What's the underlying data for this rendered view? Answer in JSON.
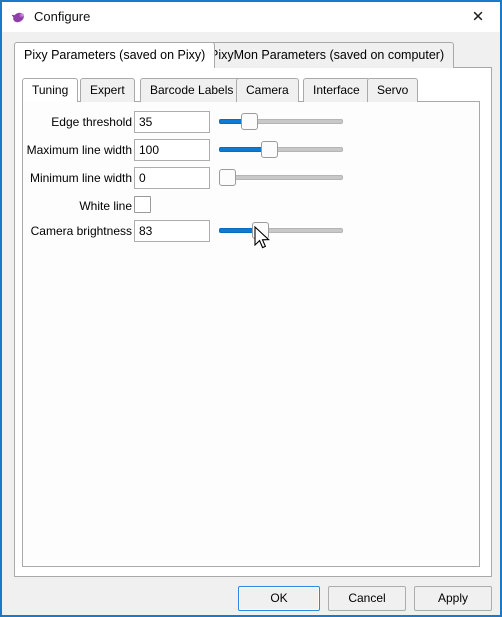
{
  "window": {
    "title": "Configure",
    "app_icon": "pixymon-logo-icon",
    "close_icon": "✕",
    "border_color": "#1a7ac8"
  },
  "outer_tabs": [
    {
      "label": "Pixy Parameters (saved on Pixy)",
      "selected": true
    },
    {
      "label": "PixyMon Parameters (saved on computer)",
      "selected": false
    }
  ],
  "inner_tabs": [
    {
      "label": "Tuning",
      "selected": true
    },
    {
      "label": "Expert",
      "selected": false
    },
    {
      "label": "Barcode Labels",
      "selected": false
    },
    {
      "label": "Camera",
      "selected": false
    },
    {
      "label": "Interface",
      "selected": false
    },
    {
      "label": "Servo",
      "selected": false
    }
  ],
  "form": {
    "rows": [
      {
        "label": "Edge threshold",
        "type": "slider",
        "value": "35",
        "percent": 24
      },
      {
        "label": "Maximum line width",
        "type": "slider",
        "value": "100",
        "percent": 40
      },
      {
        "label": "Minimum line width",
        "type": "slider",
        "value": "0",
        "percent": 0
      },
      {
        "label": "White line",
        "type": "checkbox",
        "checked": false
      },
      {
        "label": "Camera brightness",
        "type": "slider",
        "value": "83",
        "percent": 33
      }
    ]
  },
  "buttons": {
    "ok": "OK",
    "cancel": "Cancel",
    "apply": "Apply"
  },
  "colors": {
    "slider_fill": "#0f7ad2",
    "accent": "#2a8ae0"
  }
}
